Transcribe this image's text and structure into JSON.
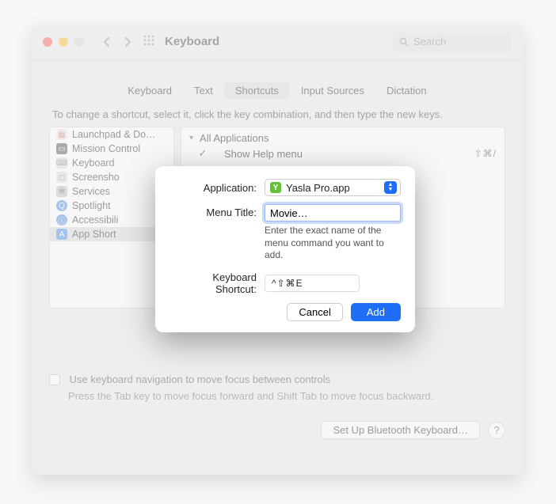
{
  "title": "Keyboard",
  "search": {
    "placeholder": "Search"
  },
  "tabs": [
    "Keyboard",
    "Text",
    "Shortcuts",
    "Input Sources",
    "Dictation"
  ],
  "activeTab": 2,
  "description": "To change a shortcut, select it, click the key combination, and then type the new keys.",
  "categories": [
    {
      "label": "Launchpad & Do…"
    },
    {
      "label": "Mission Control"
    },
    {
      "label": "Keyboard"
    },
    {
      "label": "Screensho"
    },
    {
      "label": "Services"
    },
    {
      "label": "Spotlight"
    },
    {
      "label": "Accessibili"
    },
    {
      "label": "App Short"
    }
  ],
  "details": {
    "header": "All Applications",
    "row": {
      "label": "Show Help menu",
      "shortcut": "⇧⌘/"
    }
  },
  "plus": "+",
  "minus": "−",
  "nav_checkbox_label": "Use keyboard navigation to move focus between controls",
  "nav_help": "Press the Tab key to move focus forward and Shift Tab to move focus backward.",
  "setup_btn": "Set Up Bluetooth Keyboard…",
  "help": "?",
  "modal": {
    "app_label": "Application:",
    "app_value": "Yasla Pro.app",
    "title_label": "Menu Title:",
    "title_value": "Movie…",
    "title_help": "Enter the exact name of the menu command you want to add.",
    "sc_label": "Keyboard Shortcut:",
    "sc_value": "^⇧⌘E",
    "cancel": "Cancel",
    "add": "Add"
  }
}
